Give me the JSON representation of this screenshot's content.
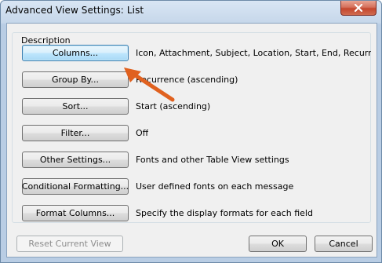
{
  "window": {
    "title": "Advanced View Settings: List"
  },
  "icons": {
    "close": "close-icon",
    "annotation": "orange-arrow-annotation"
  },
  "colors": {
    "close_button": "#c4462e",
    "arrow": "#e0611f",
    "focus_border": "#3c7fb1"
  },
  "group": {
    "label": "Description",
    "rows": [
      {
        "button": "Columns...",
        "description": "Icon, Attachment, Subject, Location, Start, End, Recurrenc..."
      },
      {
        "button": "Group By...",
        "description": "Recurrence (ascending)"
      },
      {
        "button": "Sort...",
        "description": "Start (ascending)"
      },
      {
        "button": "Filter...",
        "description": "Off"
      },
      {
        "button": "Other Settings...",
        "description": "Fonts and other Table View settings"
      },
      {
        "button": "Conditional Formatting...",
        "description": "User defined fonts on each message"
      },
      {
        "button": "Format Columns...",
        "description": "Specify the display formats for each field"
      }
    ]
  },
  "footer": {
    "reset_label": "Reset Current View",
    "ok_label": "OK",
    "cancel_label": "Cancel"
  }
}
